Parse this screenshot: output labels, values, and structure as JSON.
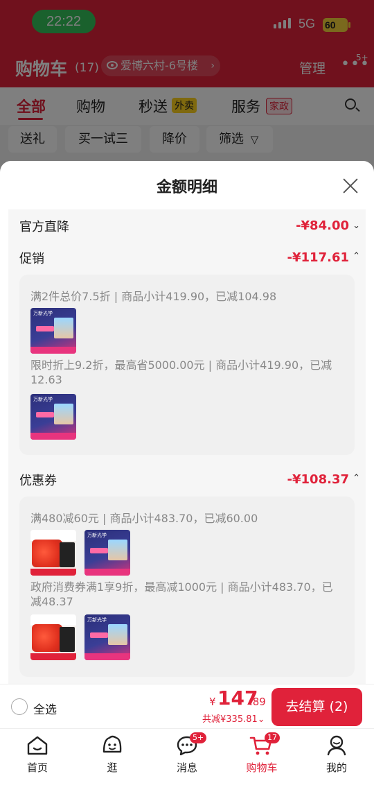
{
  "status_bar": {
    "time": "22:22",
    "network": "5G",
    "battery": "60"
  },
  "header": {
    "title": "购物车",
    "count": "(17)",
    "address": "爱博六村-6号楼",
    "manage": "管理",
    "more_badge": "5+"
  },
  "tabs": [
    {
      "label": "全部"
    },
    {
      "label": "购物"
    },
    {
      "label": "秒送",
      "tag": "外卖"
    },
    {
      "label": "服务",
      "tag": "家政"
    }
  ],
  "chips": [
    "送礼",
    "买一试三",
    "降价",
    "筛选"
  ],
  "sheet": {
    "title": "金额明细",
    "official": {
      "label": "官方直降",
      "amount": "-¥84.00"
    },
    "promo": {
      "label": "促销",
      "amount": "-¥117.61",
      "lines": [
        "满2件总价7.5折 | 商品小计419.90，已减104.98",
        "限时折上9.2折，最高省5000.00元 | 商品小计419.90，已减12.63"
      ]
    },
    "coupon": {
      "label": "优惠券",
      "amount": "-¥108.37",
      "lines": [
        "满480减60元 | 商品小计483.70，已减60.00",
        "政府消费券满1享9折，最高减1000元 | 商品小计483.70，已减48.37"
      ]
    }
  },
  "checkout": {
    "select_all": "全选",
    "currency": "¥",
    "price_int": "147",
    "price_dec": ".89",
    "saved": "共减¥335.81",
    "button": "去结算 (2)"
  },
  "tabbar": [
    {
      "label": "首页"
    },
    {
      "label": "逛"
    },
    {
      "label": "消息",
      "badge": "5+"
    },
    {
      "label": "购物车",
      "badge": "17"
    },
    {
      "label": "我的"
    }
  ],
  "colors": {
    "brand_red": "#e0223a",
    "status_green": "#35c25a"
  }
}
